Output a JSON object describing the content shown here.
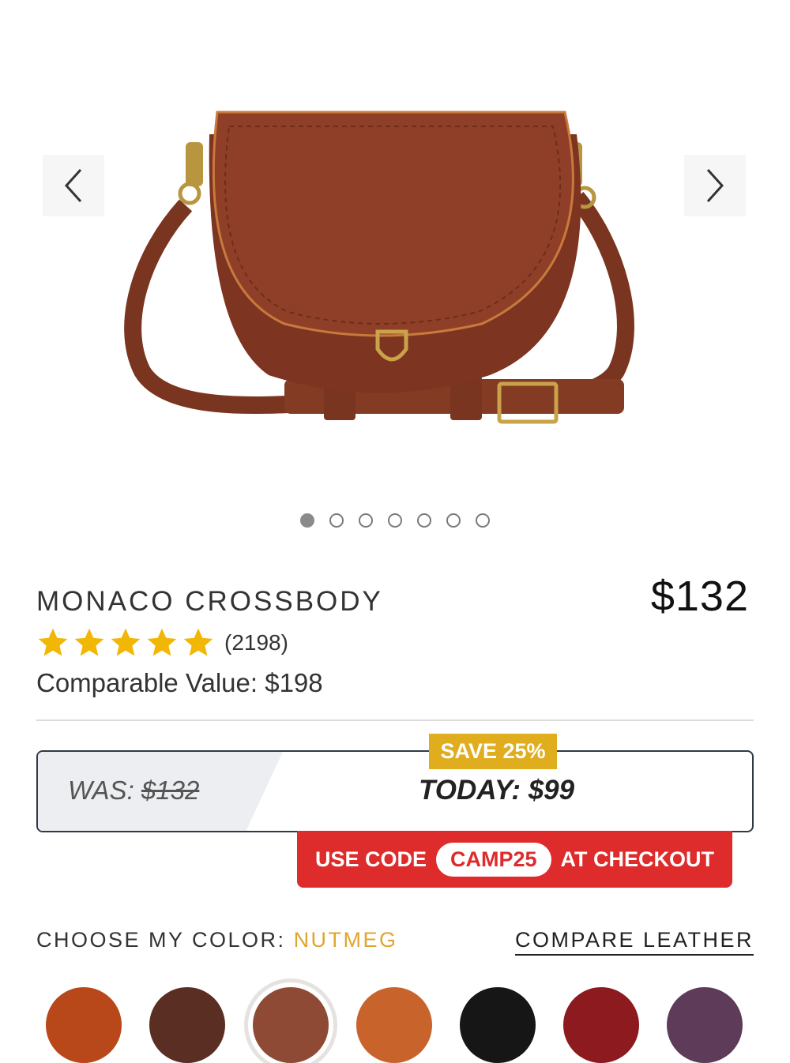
{
  "gallery": {
    "prev_icon": "chevron-left-icon",
    "next_icon": "chevron-right-icon",
    "image_count": 7,
    "active_index": 0
  },
  "product": {
    "name": "MONACO CROSSBODY",
    "price": "$132",
    "rating_stars": 5,
    "review_count": "(2198)",
    "comparable_value": "Comparable Value: $198"
  },
  "promo": {
    "badge": "SAVE 25%",
    "was_label": "WAS:",
    "was_price": "$132",
    "today": "TODAY: $99",
    "code_prefix": "USE CODE",
    "code": "CAMP25",
    "code_suffix": "AT CHECKOUT",
    "colors": {
      "badge": "#e0ad1f",
      "banner": "#de2b2b"
    }
  },
  "color_picker": {
    "label": "CHOOSE MY COLOR: ",
    "selected_color": "NUTMEG",
    "compare_link": "COMPARE LEATHER",
    "swatches": [
      "#b8481a",
      "#5a2e22",
      "#8e4a34",
      "#c8642b",
      "#161616",
      "#8c1a1f",
      "#5e3b58"
    ],
    "selected_index": 2
  }
}
